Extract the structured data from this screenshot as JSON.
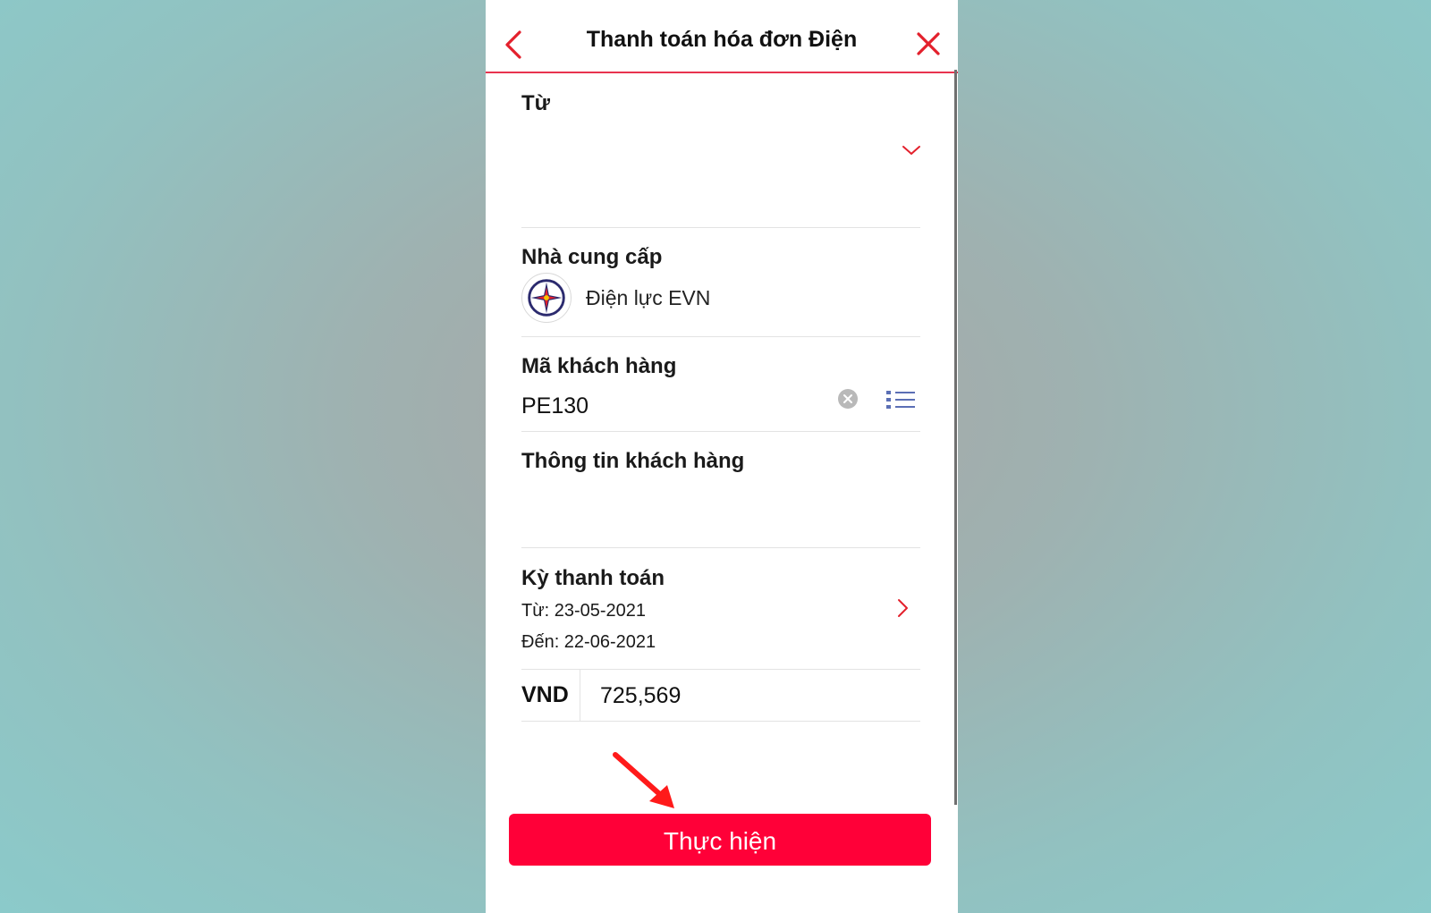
{
  "header": {
    "title": "Thanh toán hóa đơn Điện"
  },
  "form": {
    "from_label": "Từ",
    "provider_label": "Nhà cung cấp",
    "provider_name": "Điện lực EVN",
    "customer_code_label": "Mã khách hàng",
    "customer_code_value": "PE130",
    "customer_info_label": "Thông tin khách hàng",
    "billing_period_label": "Kỳ thanh toán",
    "period_from": "Từ: 23-05-2021",
    "period_to": "Đến: 22-06-2021",
    "currency": "VND",
    "amount": "725,569"
  },
  "actions": {
    "submit_label": "Thực hiện"
  },
  "colors": {
    "accent": "#ff0038",
    "icon_red": "#e3202c",
    "list_icon": "#5b6fb5"
  }
}
